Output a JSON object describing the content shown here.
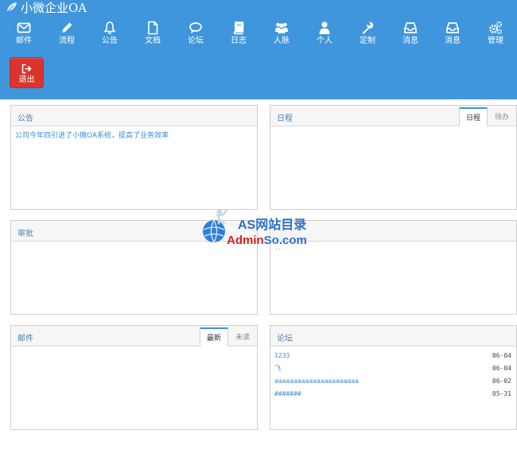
{
  "app": {
    "title": "小微企业OA"
  },
  "nav": {
    "items": [
      {
        "label": "邮件",
        "icon": "mail-icon"
      },
      {
        "label": "流程",
        "icon": "pencil-icon"
      },
      {
        "label": "公告",
        "icon": "bell-icon"
      },
      {
        "label": "文档",
        "icon": "document-icon"
      },
      {
        "label": "论坛",
        "icon": "chat-icon"
      },
      {
        "label": "日志",
        "icon": "book-icon"
      },
      {
        "label": "人脉",
        "icon": "people-icon"
      },
      {
        "label": "个人",
        "icon": "user-icon"
      },
      {
        "label": "定制",
        "icon": "wrench-icon"
      },
      {
        "label": "消息",
        "icon": "inbox-icon"
      },
      {
        "label": "消息",
        "icon": "inbox-icon"
      },
      {
        "label": "管理",
        "icon": "gears-icon"
      }
    ],
    "logout_label": "退出"
  },
  "panels": {
    "notice": {
      "title": "公告",
      "content": "公司今年四引进了小微OA系统，提高了业务效率"
    },
    "schedule": {
      "title": "日程",
      "tabs": [
        "日程",
        "待办"
      ]
    },
    "approval": {
      "title": "审批"
    },
    "middle_right": {
      "partial_text": "..."
    },
    "mail": {
      "title": "邮件",
      "tabs": [
        "最新",
        "未读"
      ]
    },
    "forum": {
      "title": "论坛",
      "rows": [
        {
          "title": "1233",
          "date": "06-04"
        },
        {
          "title": "飞",
          "date": "06-04"
        },
        {
          "title": "aaaaaaaaaaaaaaaaaaaaaa",
          "date": "06-02"
        },
        {
          "title": "#######",
          "date": "05-31"
        }
      ]
    }
  },
  "watermark": {
    "line1": "AS网站目录",
    "line2_prefix": "Admin",
    "line2_suffix": "So.com"
  },
  "colors": {
    "header_bg": "#3f96dc",
    "logout_bg": "#d9342e",
    "link": "#3a8ad6"
  }
}
